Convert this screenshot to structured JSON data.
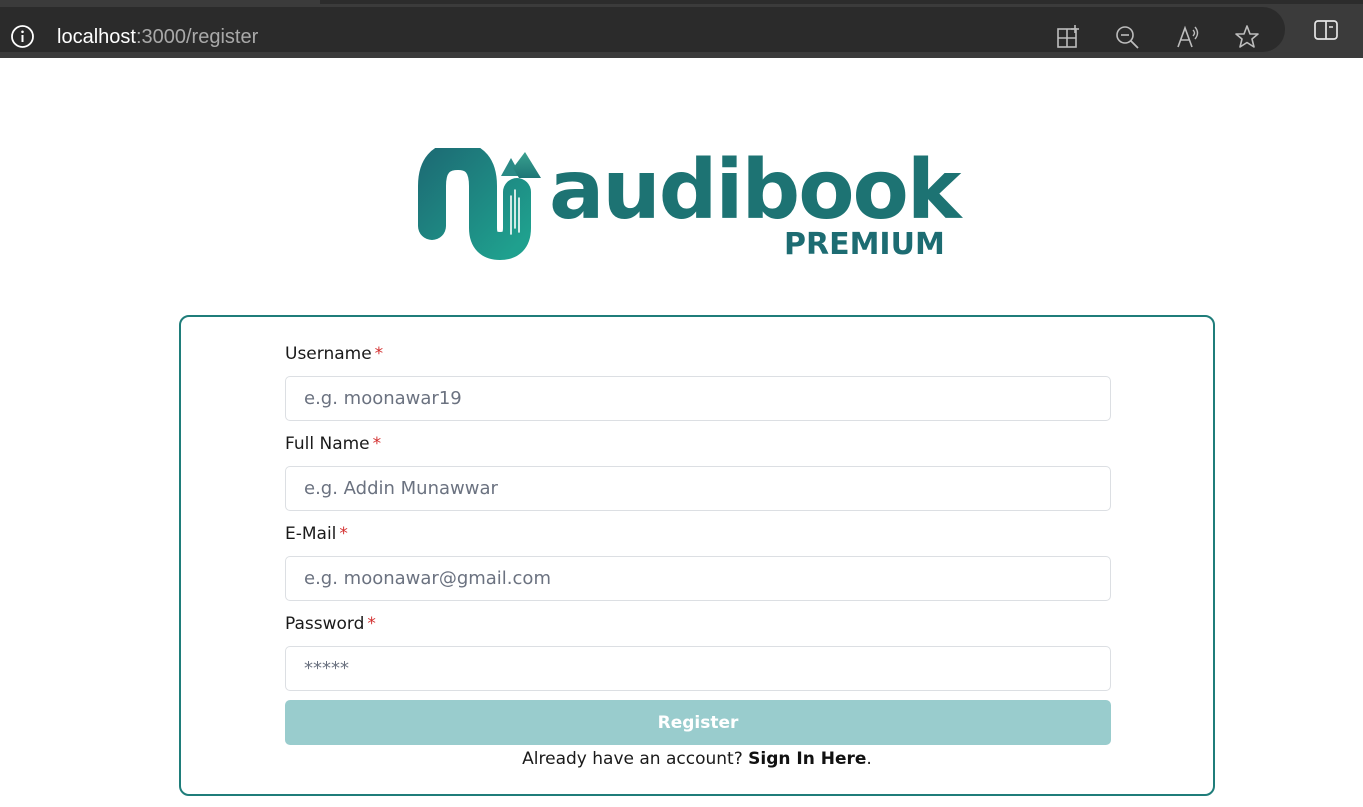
{
  "browser": {
    "url_host": "localhost",
    "url_rest": ":3000/register",
    "icons": [
      "info-icon",
      "app-available-icon",
      "zoom-out-icon",
      "read-aloud-icon",
      "favorite-star-icon",
      "split-screen-icon"
    ]
  },
  "logo": {
    "word": "audibook",
    "sub": "PREMIUM",
    "colors": {
      "teal_dark": "#1d7373",
      "teal_light": "#1fa08e"
    }
  },
  "form": {
    "fields": [
      {
        "label": "Username",
        "required_mark": "*",
        "placeholder": "e.g. moonawar19",
        "value": ""
      },
      {
        "label": "Full Name",
        "required_mark": "*",
        "placeholder": "e.g. Addin Munawwar",
        "value": ""
      },
      {
        "label": "E-Mail",
        "required_mark": "*",
        "placeholder": "e.g. moonawar@gmail.com",
        "value": ""
      },
      {
        "label": "Password",
        "required_mark": "*",
        "placeholder": "*****",
        "value": ""
      }
    ],
    "submit_label": "Register",
    "signin_prompt": "Already have an account? ",
    "signin_link": "Sign In Here",
    "signin_suffix": ".",
    "colors": {
      "border": "#1f7d7a",
      "button": "#99cccd",
      "required": "#d32f2f"
    }
  }
}
